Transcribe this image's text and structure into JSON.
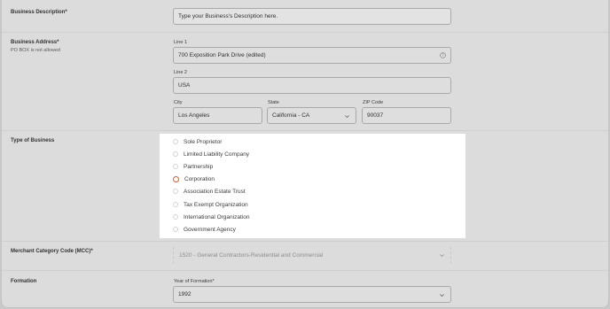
{
  "business_description": {
    "label": "Business Description*",
    "value": "Type your Business's Description here."
  },
  "business_address": {
    "label": "Business Address*",
    "note": "PO BOX is not allowed",
    "line1_label": "Line 1",
    "line1_value": "700 Exposition Park Drive (edited)",
    "line2_label": "Line 2",
    "line2_value": "USA",
    "city_label": "City",
    "city_value": "Los Angeles",
    "state_label": "State",
    "state_value": "California - CA",
    "zip_label": "ZIP Code",
    "zip_value": "90037"
  },
  "type_of_business": {
    "label": "Type of Business",
    "options": [
      {
        "label": "Sole Proprietor",
        "selected": false
      },
      {
        "label": "Limited Liability Company",
        "selected": false
      },
      {
        "label": "Partnership",
        "selected": false
      },
      {
        "label": "Corporation",
        "selected": true
      },
      {
        "label": "Association Estate Trust",
        "selected": false
      },
      {
        "label": "Tax Exempt Organization",
        "selected": false
      },
      {
        "label": "International Organization",
        "selected": false
      },
      {
        "label": "Government Agency",
        "selected": false
      }
    ],
    "selected_color": "#e05a1e"
  },
  "mcc": {
    "label": "Merchant Category Code (MCC)*",
    "value": "1520 - General Contractors-Residential and Commercial"
  },
  "formation": {
    "label": "Formation",
    "year_label": "Year of Formation*",
    "year_value": "1992"
  }
}
